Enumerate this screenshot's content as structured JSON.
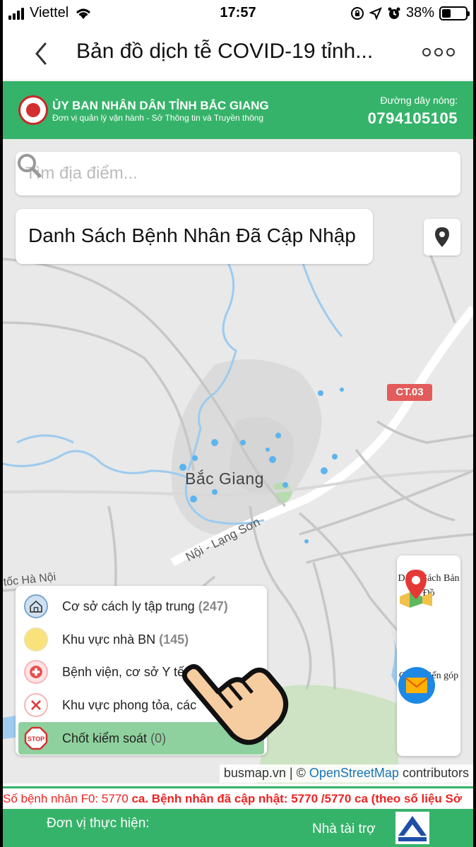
{
  "status_bar": {
    "carrier": "Viettel",
    "time": "17:57",
    "battery": "38%",
    "battery_level": 0.38
  },
  "nav": {
    "title": "Bản đồ dịch tễ COVID-19 tỉnh...",
    "back_icon": "chevron-left-icon",
    "more_icon": "more-icon"
  },
  "header": {
    "org_title": "ỦY BAN NHÂN DÂN TỈNH BẮC GIANG",
    "org_subtitle": "Đơn vị quản lý vận hành - Sở Thông tin và Truyền thông",
    "hotline_label": "Đường dây nóng:",
    "hotline_number": "0794105105",
    "color": "#36b36a"
  },
  "search": {
    "placeholder": "Tìm địa điểm...",
    "value": ""
  },
  "patient_list_button": "Danh Sách Bệnh Nhân Đã Cập Nhập",
  "map": {
    "city_label": "Bắc Giang",
    "road_badge": "CT.03",
    "road_label": "Nội - Lạng Sơn",
    "road_label_2": "tốc Hà Nội",
    "attribution_source": "busmap.vn",
    "attribution_sep": "| ©",
    "attribution_link": "OpenStreetMap",
    "attribution_suffix": "contributors"
  },
  "legend": {
    "items": [
      {
        "label": "Cơ sở cách ly tập trung",
        "count": "(247)",
        "icon": "home-icon"
      },
      {
        "label": "Khu vực nhà BN",
        "count": "(145)",
        "icon": "yellow-dot-icon"
      },
      {
        "label": "Bệnh viện, cơ sở Y tế",
        "count": "(1",
        "icon": "hospital-cross-icon"
      },
      {
        "label": "Khu vực phong tỏa, các",
        "count": "",
        "icon": "x-icon"
      },
      {
        "label": "Chốt kiểm soát",
        "count": "(0)",
        "icon": "stop-sign-icon"
      }
    ]
  },
  "side_panel": {
    "map_list": "Danh Sách Bản Đồ",
    "feedback": "Gửi ý kiến góp ý"
  },
  "ticker": {
    "prefix": "Số bệnh nhân F0: 5770",
    "mid": "ca. Bệnh nhân đã cập nhật:",
    "updated": "5770 /5770",
    "suffix": "ca (theo số liệu Sở"
  },
  "footer": {
    "implementer": "Đơn vị thực hiện:",
    "sponsor": "Nhà tài trợ"
  }
}
